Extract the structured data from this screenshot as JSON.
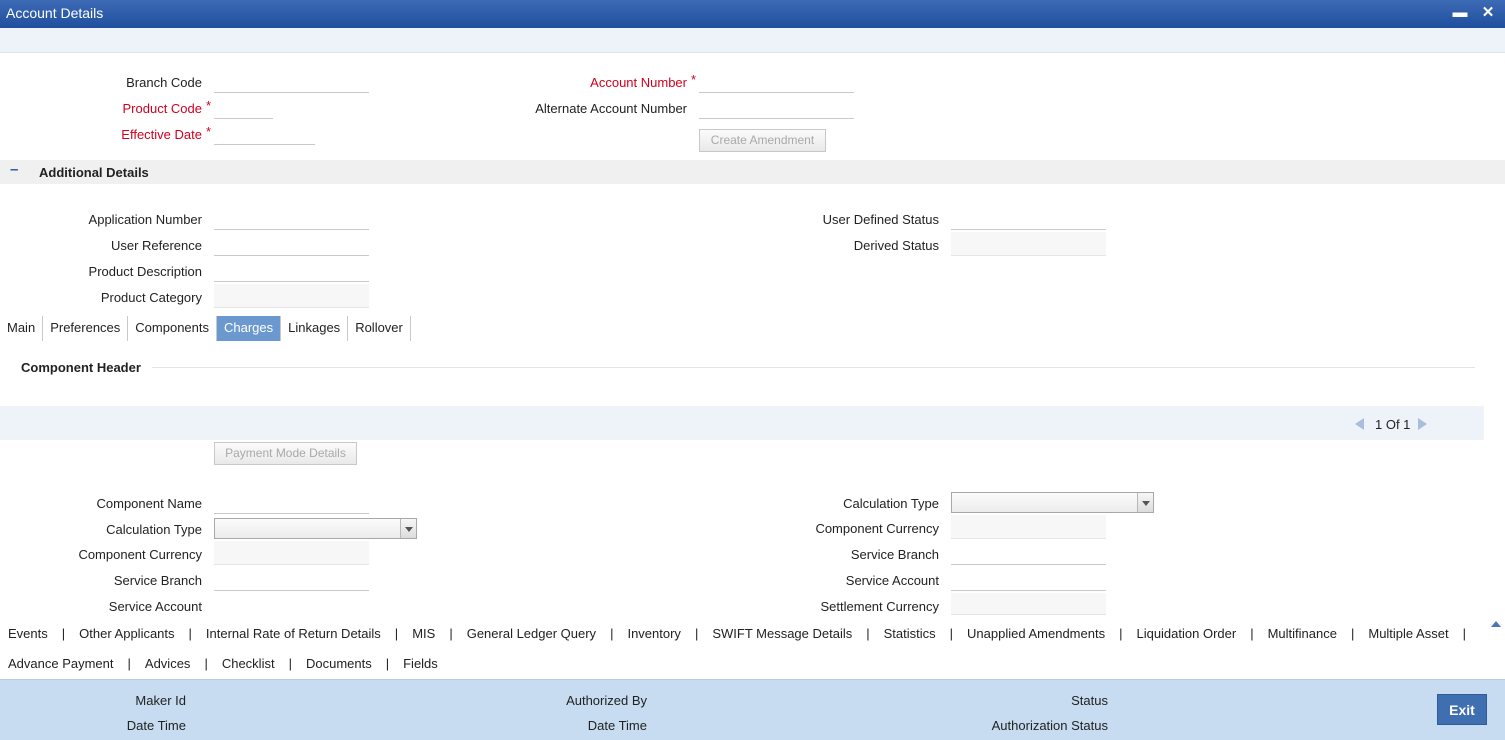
{
  "window": {
    "title": "Account Details",
    "minimize_glyph": "▬",
    "close_glyph": "✕"
  },
  "header": {
    "branch_code_label": "Branch Code",
    "product_code_label": "Product Code",
    "effective_date_label": "Effective Date",
    "account_number_label": "Account Number",
    "alternate_account_number_label": "Alternate Account Number",
    "required_marker": "*",
    "create_amendment_button": "Create Amendment"
  },
  "additional_details": {
    "title": "Additional Details",
    "collapse_glyph": "–",
    "application_number_label": "Application Number",
    "user_reference_label": "User Reference",
    "product_description_label": "Product Description",
    "product_category_label": "Product Category",
    "user_defined_status_label": "User Defined Status",
    "derived_status_label": "Derived Status"
  },
  "tabs": [
    "Main",
    "Preferences",
    "Components",
    "Charges",
    "Linkages",
    "Rollover"
  ],
  "active_tab": "Charges",
  "charges": {
    "component_header": "Component Header",
    "pager_text": "1 Of 1",
    "payment_mode_details_button": "Payment Mode Details",
    "left": {
      "component_name_label": "Component Name",
      "calculation_type_label": "Calculation Type",
      "component_currency_label": "Component Currency",
      "service_branch_label": "Service Branch",
      "service_account_label": "Service Account"
    },
    "right": {
      "calculation_type_label": "Calculation Type",
      "component_currency_label": "Component Currency",
      "service_branch_label": "Service Branch",
      "service_account_label": "Service Account",
      "settlement_currency_label": "Settlement Currency"
    }
  },
  "links_row1": [
    "Events",
    "Other Applicants",
    "Internal Rate of Return Details",
    "MIS",
    "General Ledger Query",
    "Inventory",
    "SWIFT Message Details",
    "Statistics",
    "Unapplied Amendments",
    "Liquidation Order",
    "Multifinance",
    "Multiple Asset"
  ],
  "links_row2": [
    "Advance Payment",
    "Advices",
    "Checklist",
    "Documents",
    "Fields"
  ],
  "link_separator": "|",
  "footer": {
    "maker_id_label": "Maker Id",
    "maker_date_time_label": "Date Time",
    "authorized_by_label": "Authorized By",
    "checker_date_time_label": "Date Time",
    "status_label": "Status",
    "authorization_status_label": "Authorization Status",
    "exit_button": "Exit"
  },
  "colors": {
    "title_bar": "#1f4f9e",
    "active_tab": "#6b98cf",
    "required": "#d2001f",
    "footer": "#c7dcf0",
    "exit_button": "#3f6fb0"
  }
}
